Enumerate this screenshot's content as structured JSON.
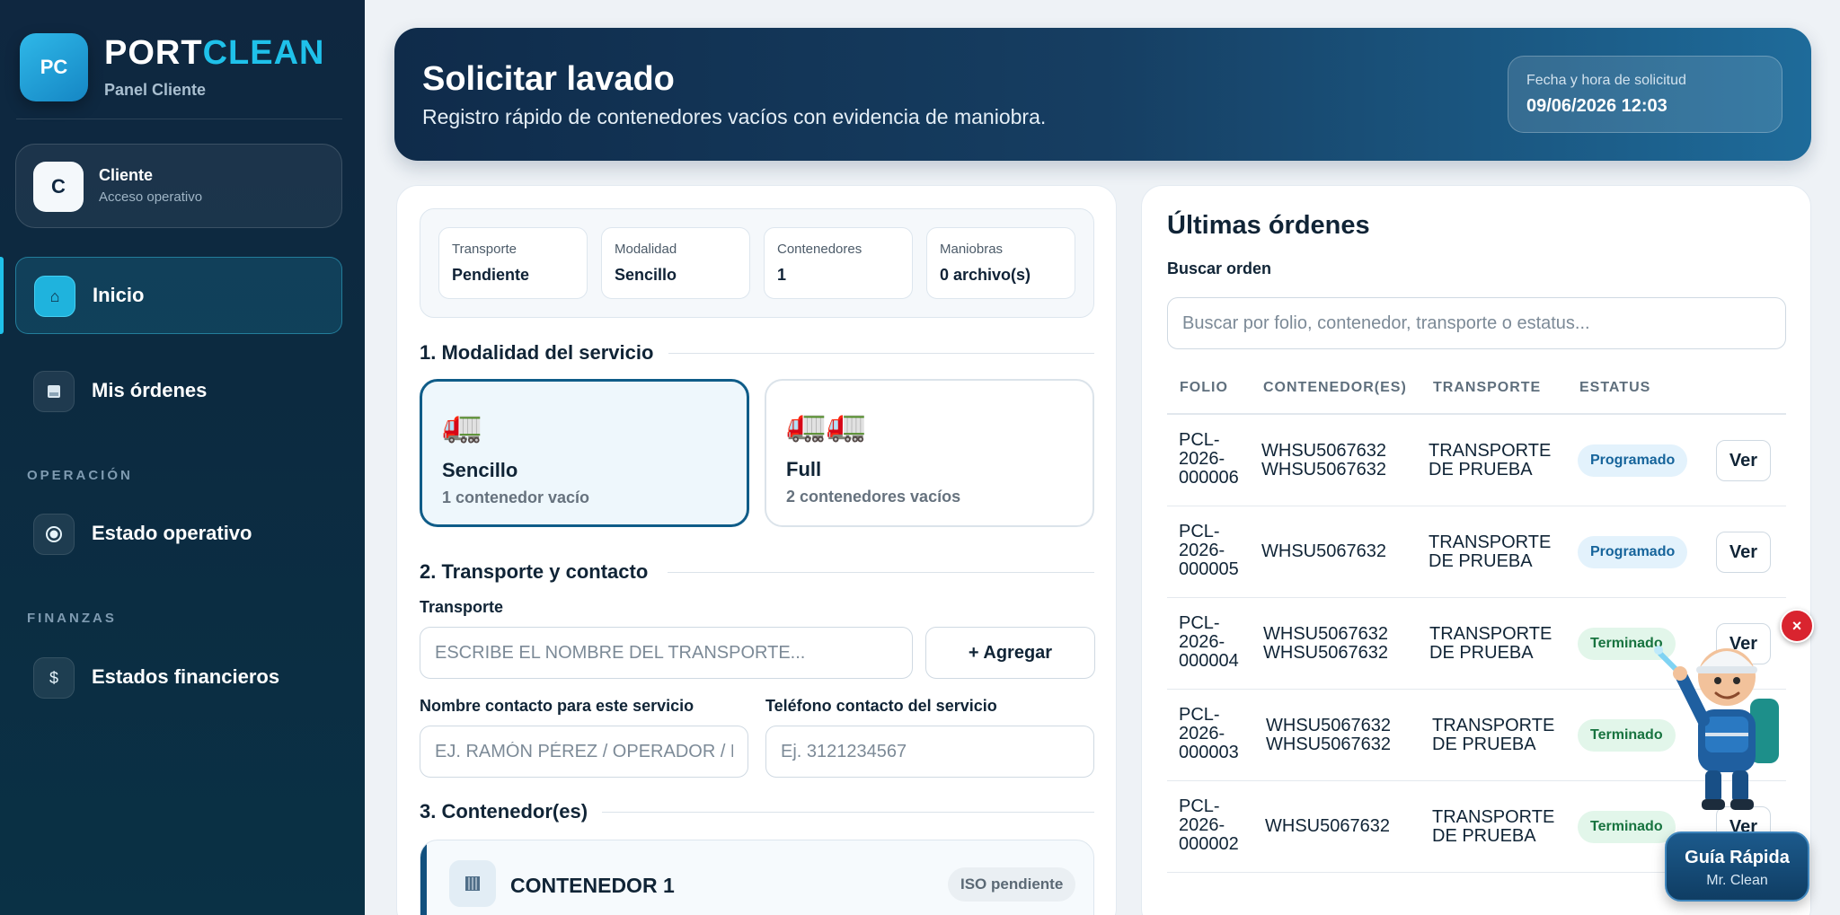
{
  "brand": {
    "logo": "PC",
    "name_part1": "PORT",
    "name_part2": "CLEAN",
    "subtitle": "Panel Cliente"
  },
  "user": {
    "initial": "C",
    "name": "Cliente",
    "role": "Acceso operativo"
  },
  "nav": {
    "inicio": "Inicio",
    "mis_ordenes": "Mis órdenes",
    "section_operacion": "OPERACIÓN",
    "estado_operativo": "Estado operativo",
    "section_finanzas": "FINANZAS",
    "estados_financieros": "Estados financieros"
  },
  "header": {
    "title": "Solicitar lavado",
    "subtitle": "Registro rápido de contenedores vacíos con evidencia de maniobra.",
    "date_label": "Fecha y hora de solicitud",
    "date_value": "09/06/2026 12:03"
  },
  "summary": [
    {
      "label": "Transporte",
      "value": "Pendiente"
    },
    {
      "label": "Modalidad",
      "value": "Sencillo"
    },
    {
      "label": "Contenedores",
      "value": "1"
    },
    {
      "label": "Maniobras",
      "value": "0 archivo(s)"
    }
  ],
  "section1": {
    "title": "1. Modalidad del servicio",
    "options": [
      {
        "icon": "🚛",
        "name": "Sencillo",
        "desc": "1 contenedor vacío",
        "selected": true
      },
      {
        "icon": "🚛🚛",
        "name": "Full",
        "desc": "2 contenedores vacíos",
        "selected": false
      }
    ]
  },
  "section2": {
    "title": "2. Transporte y contacto",
    "transport_label": "Transporte",
    "transport_placeholder": "ESCRIBE EL NOMBRE DEL TRANSPORTE...",
    "add_button": "+ Agregar",
    "contact_label": "Nombre contacto para este servicio",
    "contact_placeholder": "EJ. RAMÓN PÉREZ / OPERADOR / PATIO",
    "phone_label": "Teléfono contacto del servicio",
    "phone_placeholder": "Ej. 3121234567"
  },
  "section3": {
    "title": "3. Contenedor(es)",
    "container_title": "CONTENEDOR 1",
    "iso_badge": "ISO pendiente"
  },
  "orders": {
    "title": "Últimas órdenes",
    "search_label": "Buscar orden",
    "search_placeholder": "Buscar por folio, contenedor, transporte o estatus...",
    "columns": [
      "FOLIO",
      "CONTENEDOR(ES)",
      "TRANSPORTE",
      "ESTATUS"
    ],
    "view_label": "Ver",
    "rows": [
      {
        "folio_1": "PCL-",
        "folio_2": "2026-",
        "folio_3": "000006",
        "cont_1": "WHSU5067632",
        "cont_2": "WHSU5067632",
        "trans_1": "TRANSPORTE",
        "trans_2": "DE PRUEBA",
        "status": "Programado"
      },
      {
        "folio_1": "PCL-",
        "folio_2": "2026-",
        "folio_3": "000005",
        "cont_1": "WHSU5067632",
        "cont_2": "",
        "trans_1": "TRANSPORTE",
        "trans_2": "DE PRUEBA",
        "status": "Programado"
      },
      {
        "folio_1": "PCL-",
        "folio_2": "2026-",
        "folio_3": "000004",
        "cont_1": "WHSU5067632",
        "cont_2": "WHSU5067632",
        "trans_1": "TRANSPORTE",
        "trans_2": "DE PRUEBA",
        "status": "Terminado"
      },
      {
        "folio_1": "PCL-",
        "folio_2": "2026-",
        "folio_3": "000003",
        "cont_1": "WHSU5067632",
        "cont_2": "WHSU5067632",
        "trans_1": "TRANSPORTE",
        "trans_2": "DE PRUEBA",
        "status": "Terminado"
      },
      {
        "folio_1": "PCL-",
        "folio_2": "2026-",
        "folio_3": "000002",
        "cont_1": "WHSU5067632",
        "cont_2": "",
        "trans_1": "TRANSPORTE",
        "trans_2": "DE PRUEBA",
        "status": "Terminado"
      }
    ]
  },
  "guide": {
    "title": "Guía Rápida",
    "subtitle": "Mr. Clean",
    "close": "×"
  },
  "colors": {
    "accent": "#1fc1ea",
    "navy": "#0f2740",
    "programado": "#16649b",
    "terminado": "#17733f"
  },
  "icons": {
    "inicio": "home-icon",
    "mis_ordenes": "orders-icon",
    "estado_operativo": "radar-icon",
    "estados_financieros": "dollar-icon",
    "contenedor": "container-icon"
  }
}
